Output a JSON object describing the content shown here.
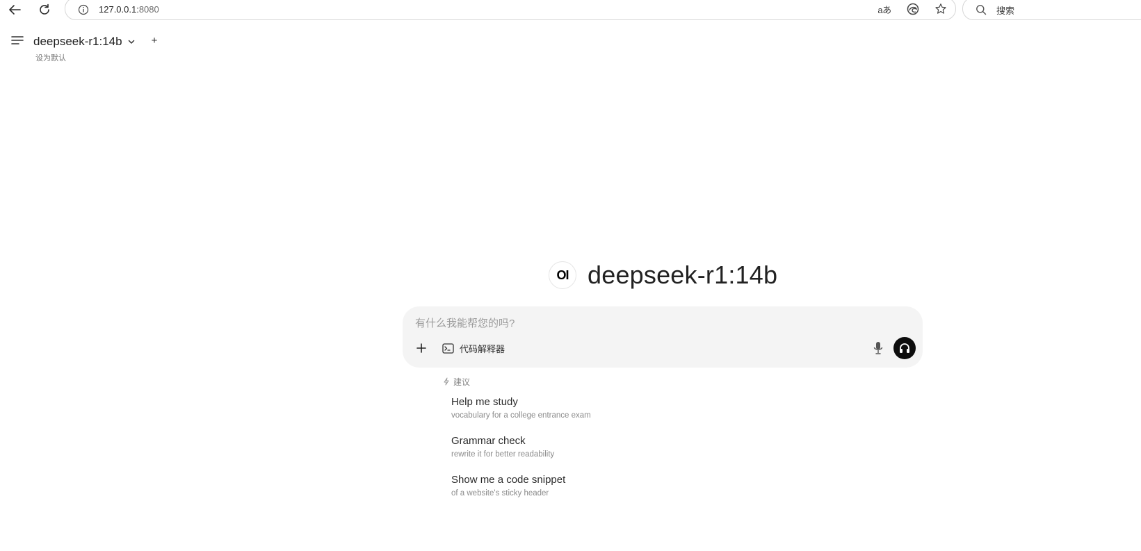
{
  "browser": {
    "url_host": "127.0.0.1:",
    "url_port": "8080",
    "read_aloud_label": "aあ",
    "search_placeholder": "搜索"
  },
  "header": {
    "model_name": "deepseek-r1:14b",
    "add_model_label": "+",
    "set_default_label": "设为默认"
  },
  "hero": {
    "logo_text": "OI",
    "title": "deepseek-r1:14b"
  },
  "composer": {
    "placeholder": "有什么我能帮您的吗?",
    "value": "",
    "code_interpreter_label": "代码解释器"
  },
  "suggestions": {
    "header": "建议",
    "items": [
      {
        "title": "Help me study",
        "subtitle": "vocabulary for a college entrance exam"
      },
      {
        "title": "Grammar check",
        "subtitle": "rewrite it for better readability"
      },
      {
        "title": "Show me a code snippet",
        "subtitle": "of a website's sticky header"
      }
    ]
  },
  "icons": {
    "back": "arrow-left-icon",
    "reload": "reload-icon",
    "info": "info-icon",
    "edge": "edge-icon",
    "favorite": "star-icon",
    "search": "search-icon",
    "menu": "menu-icon",
    "chevron": "chevron-down-icon",
    "plus": "plus-icon",
    "terminal": "terminal-icon",
    "mic": "microphone-icon",
    "headphones": "headphones-icon",
    "sparkle": "sparkle-icon"
  }
}
